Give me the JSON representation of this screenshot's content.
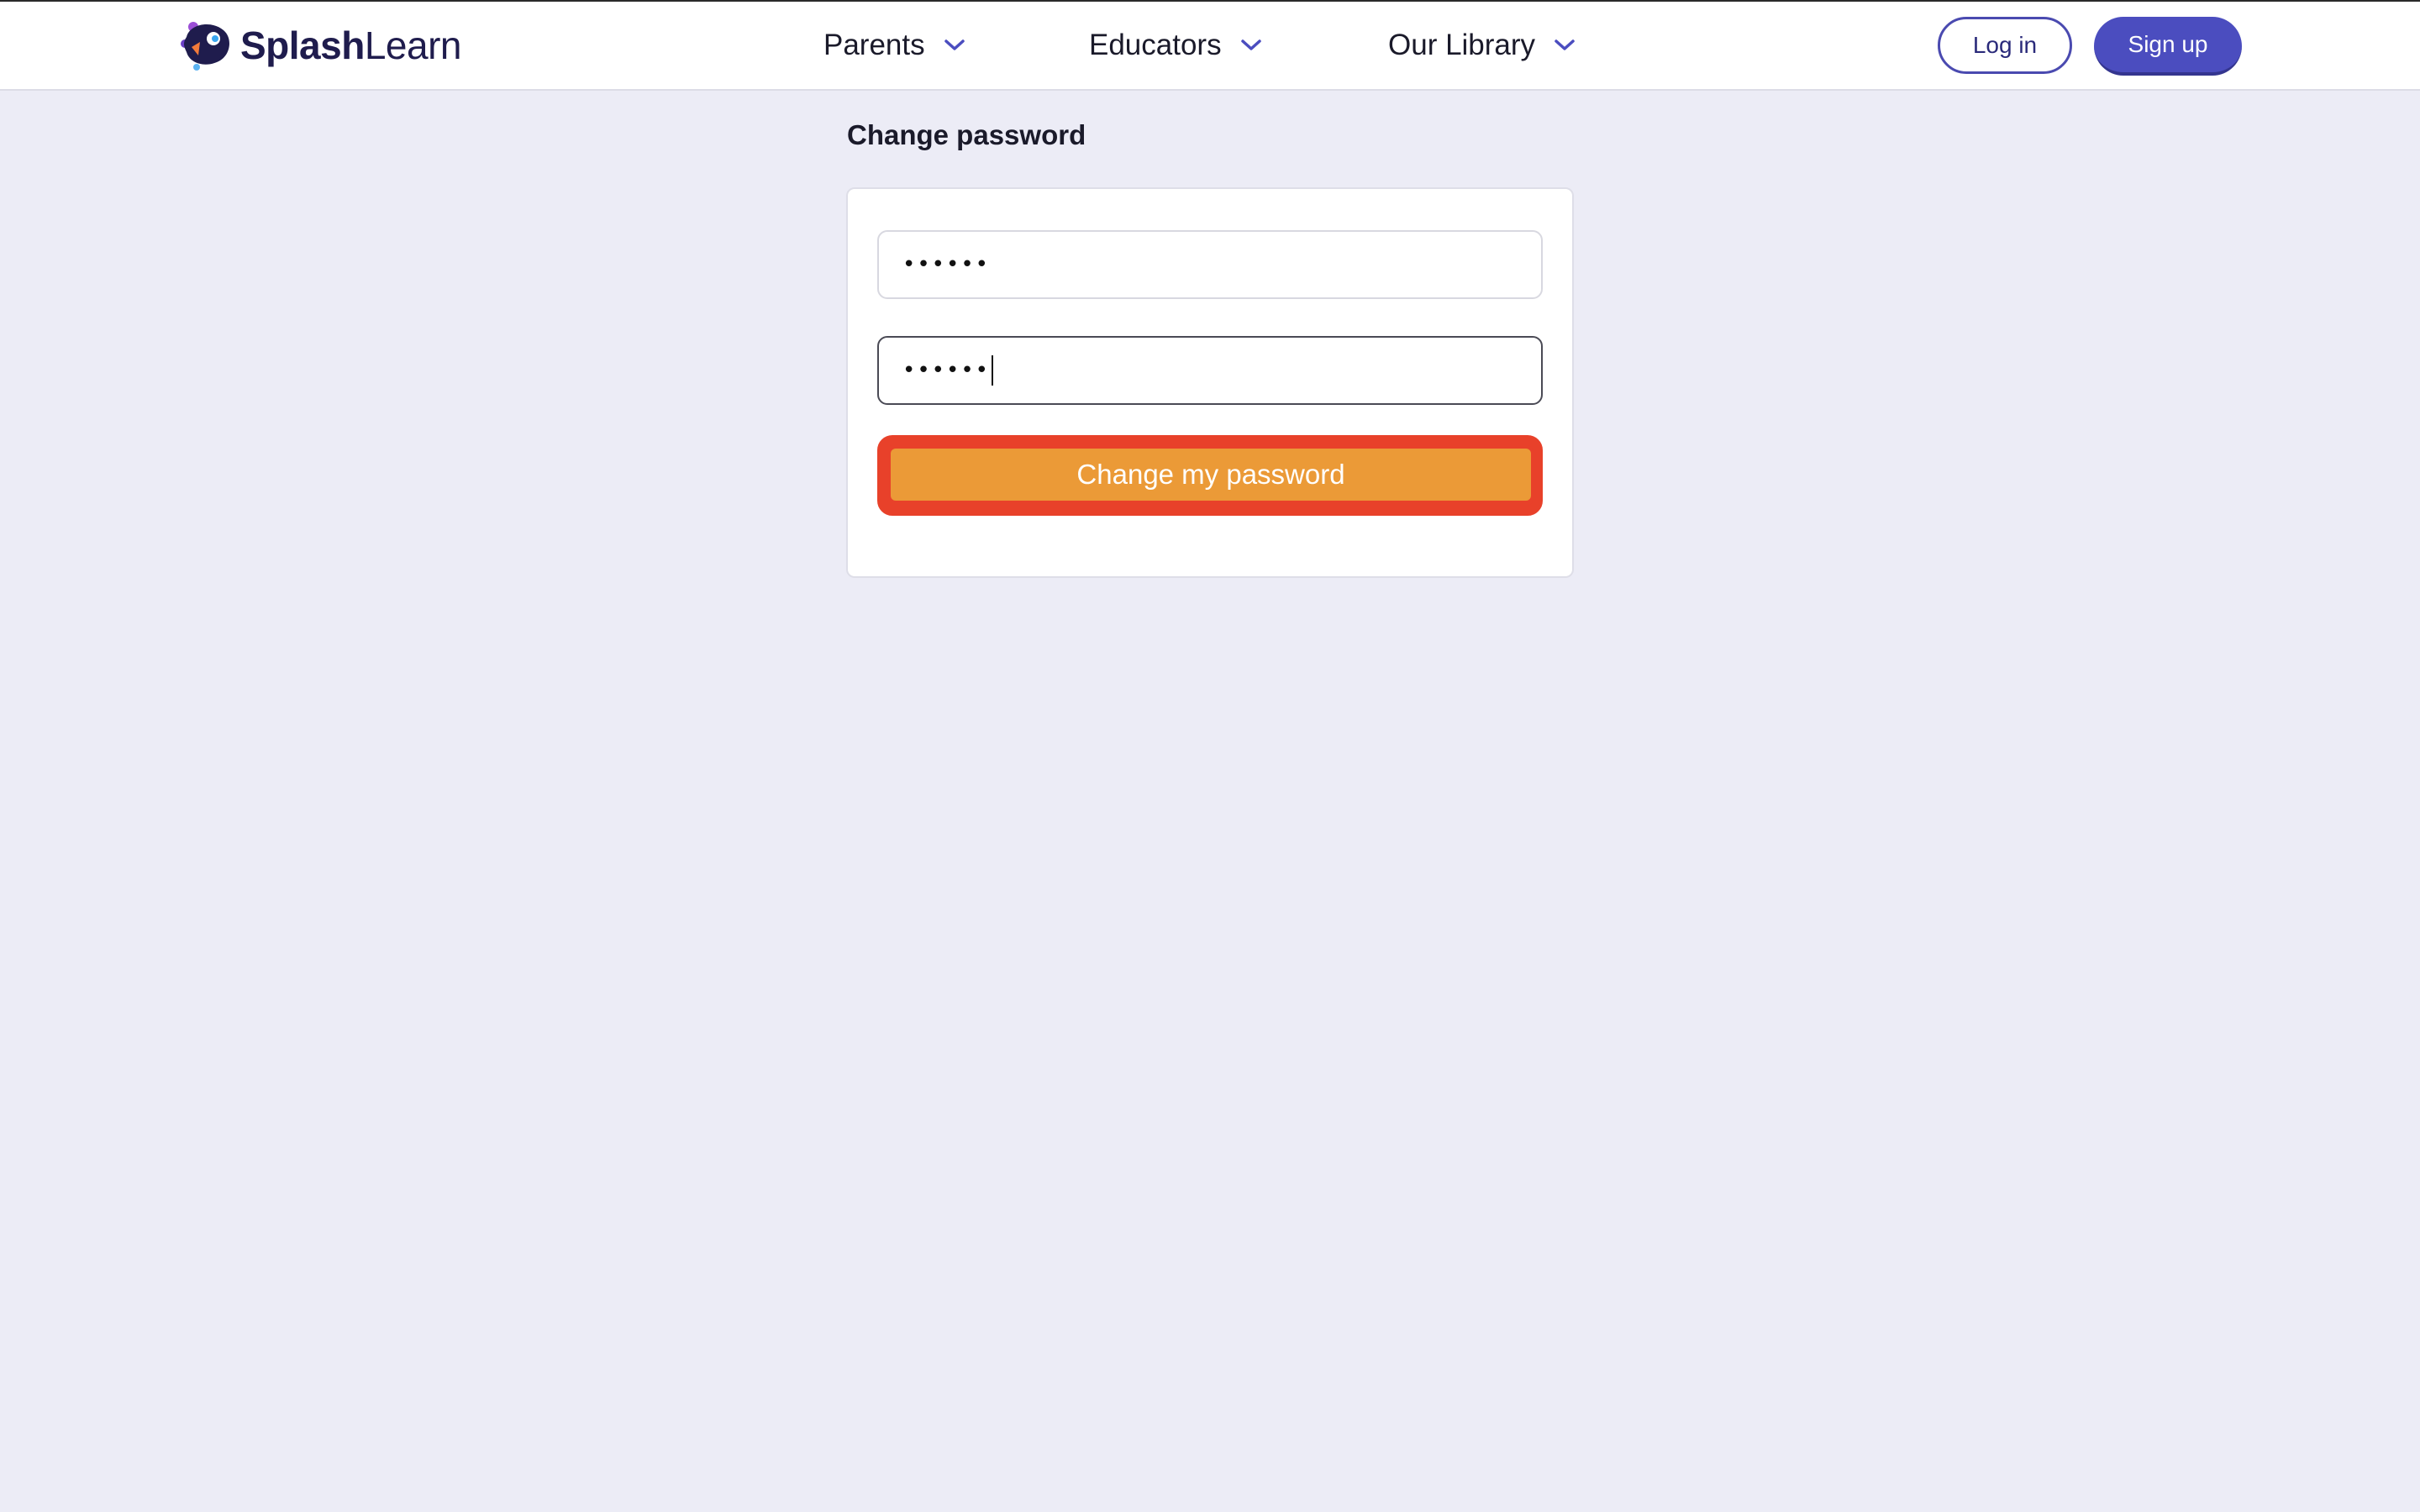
{
  "header": {
    "logo": {
      "bold": "Splash",
      "regular": "Learn"
    },
    "nav": [
      {
        "label": "Parents",
        "icon": "chevron-down-icon"
      },
      {
        "label": "Educators",
        "icon": "chevron-down-icon"
      },
      {
        "label": "Our Library",
        "icon": "chevron-down-icon"
      }
    ],
    "login_label": "Log in",
    "signup_label": "Sign up"
  },
  "main": {
    "title": "Change password",
    "current_password_value": "••••••",
    "new_password_value": "••••••",
    "submit_label": "Change my password"
  },
  "colors": {
    "background": "#ECECF6",
    "brand": "#4B4DBF",
    "submit": "#EB9A37",
    "highlight": "#E8412A"
  }
}
